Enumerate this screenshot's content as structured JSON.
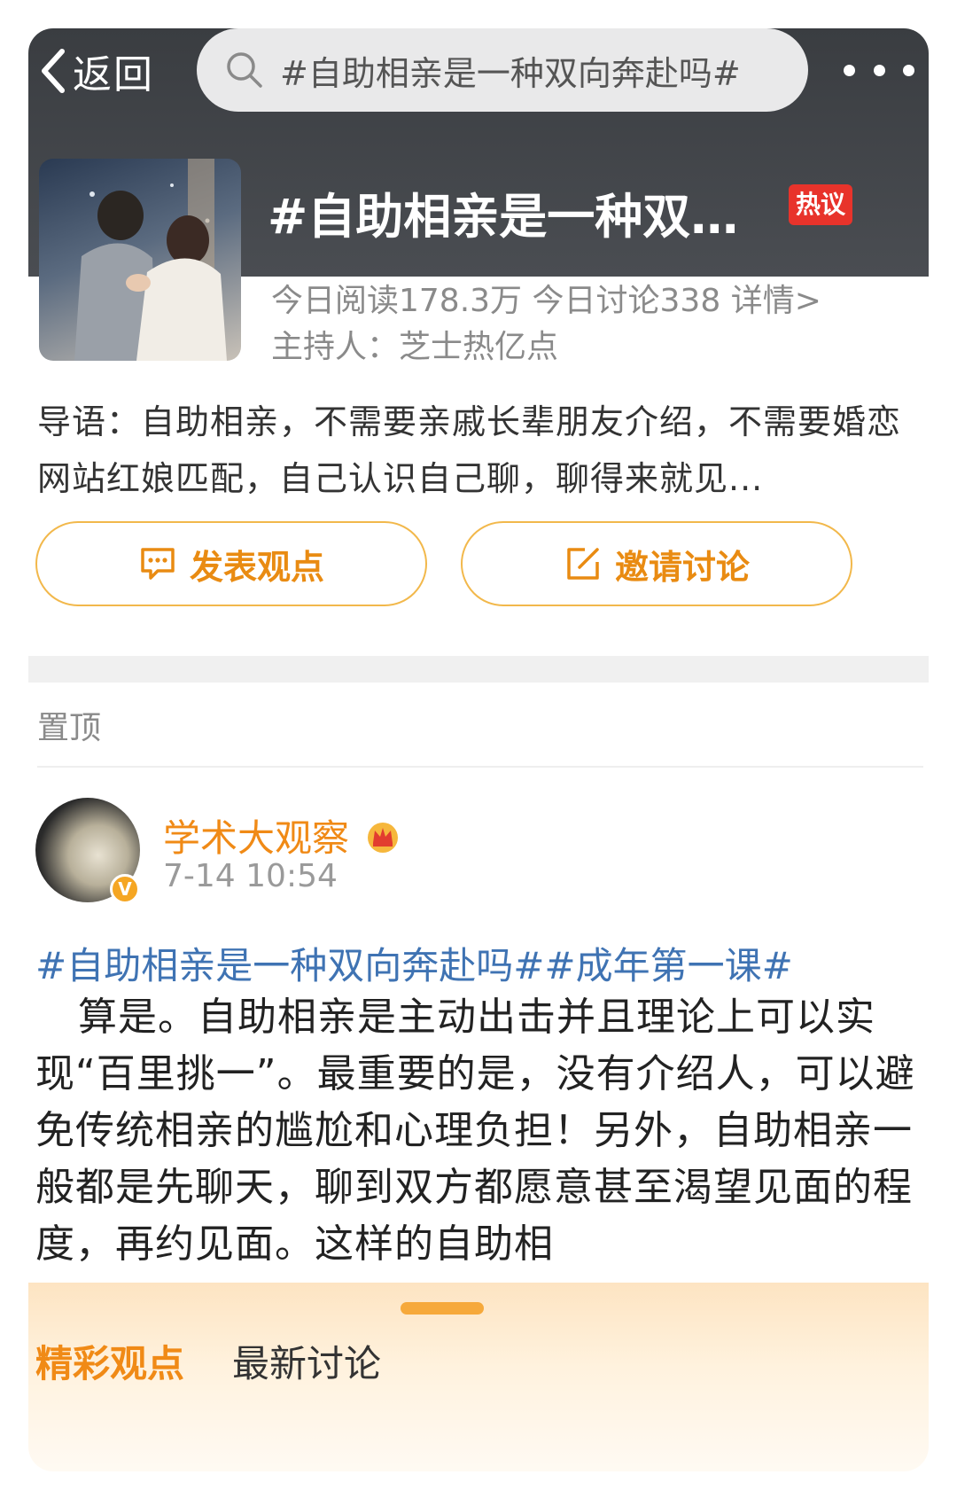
{
  "nav": {
    "back_label": "返回",
    "search_query": "#自助相亲是一种双向奔赴吗#"
  },
  "topic": {
    "title": "#自助相亲是一种双向...",
    "badge": "热议",
    "reads": "今日阅读178.3万",
    "discussions": "今日讨论338",
    "details_link": "详情>",
    "host": "主持人：芝士热亿点"
  },
  "intro": "导语：自助相亲，不需要亲戚长辈朋友介绍，不需要婚恋网站红娘匹配，自己认识自己聊，聊得来就见...",
  "actions": {
    "post_label": "发表观点",
    "invite_label": "邀请讨论"
  },
  "pinned_label": "置顶",
  "post": {
    "author": "学术大观察",
    "verified_mark": "V",
    "time": "7-14 10:54",
    "hashtags": "#自助相亲是一种双向奔赴吗##成年第一课#",
    "text": "算是。自助相亲是主动出击并且理论上可以实现“百里挑一”。最重要的是，没有介绍人，可以避免传统相亲的尴尬和心理负担！另外，自助相亲一般都是先聊天，聊到双方都愿意甚至渴望见面的程度，再约见面。这样的自助相"
  },
  "tabs": {
    "featured": "精彩观点",
    "latest": "最新讨论"
  },
  "colors": {
    "accent": "#f08a16",
    "link": "#3f73b3",
    "hot": "#e8332b",
    "header": "#3a3d41"
  },
  "icons": [
    "chevron-left-icon",
    "search-icon",
    "more-icon",
    "comment-icon",
    "edit-icon",
    "crown-icon",
    "verified-icon"
  ]
}
